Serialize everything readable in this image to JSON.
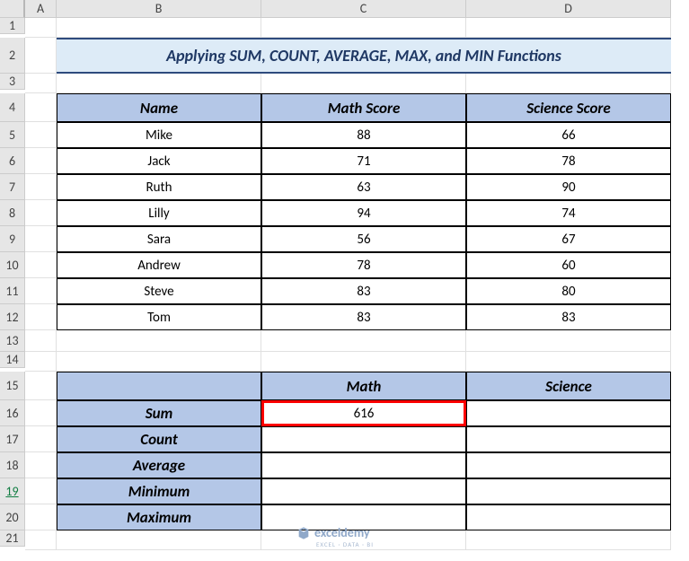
{
  "cols": [
    "A",
    "B",
    "C",
    "D"
  ],
  "rows": [
    "1",
    "2",
    "3",
    "4",
    "5",
    "6",
    "7",
    "8",
    "9",
    "10",
    "11",
    "12",
    "13",
    "14",
    "15",
    "16",
    "17",
    "18",
    "19",
    "20",
    "21"
  ],
  "title": "Applying SUM, COUNT, AVERAGE, MAX, and MIN Functions",
  "table1": {
    "headers": [
      "Name",
      "Math Score",
      "Science Score"
    ],
    "rows": [
      {
        "name": "Mike",
        "math": "88",
        "sci": "66"
      },
      {
        "name": "Jack",
        "math": "71",
        "sci": "78"
      },
      {
        "name": "Ruth",
        "math": "63",
        "sci": "90"
      },
      {
        "name": "Lilly",
        "math": "94",
        "sci": "74"
      },
      {
        "name": "Sara",
        "math": "56",
        "sci": "67"
      },
      {
        "name": "Andrew",
        "math": "78",
        "sci": "60"
      },
      {
        "name": "Steve",
        "math": "83",
        "sci": "80"
      },
      {
        "name": "Tom",
        "math": "83",
        "sci": "83"
      }
    ]
  },
  "table2": {
    "headers": [
      "",
      "Math",
      "Science"
    ],
    "stats": [
      {
        "label": "Sum",
        "math": "616",
        "sci": ""
      },
      {
        "label": "Count",
        "math": "",
        "sci": ""
      },
      {
        "label": "Average",
        "math": "",
        "sci": ""
      },
      {
        "label": "Minimum",
        "math": "",
        "sci": ""
      },
      {
        "label": "Maximum",
        "math": "",
        "sci": ""
      }
    ]
  },
  "watermark": {
    "brand": "exceldemy",
    "sub": "EXCEL · DATA · BI"
  }
}
